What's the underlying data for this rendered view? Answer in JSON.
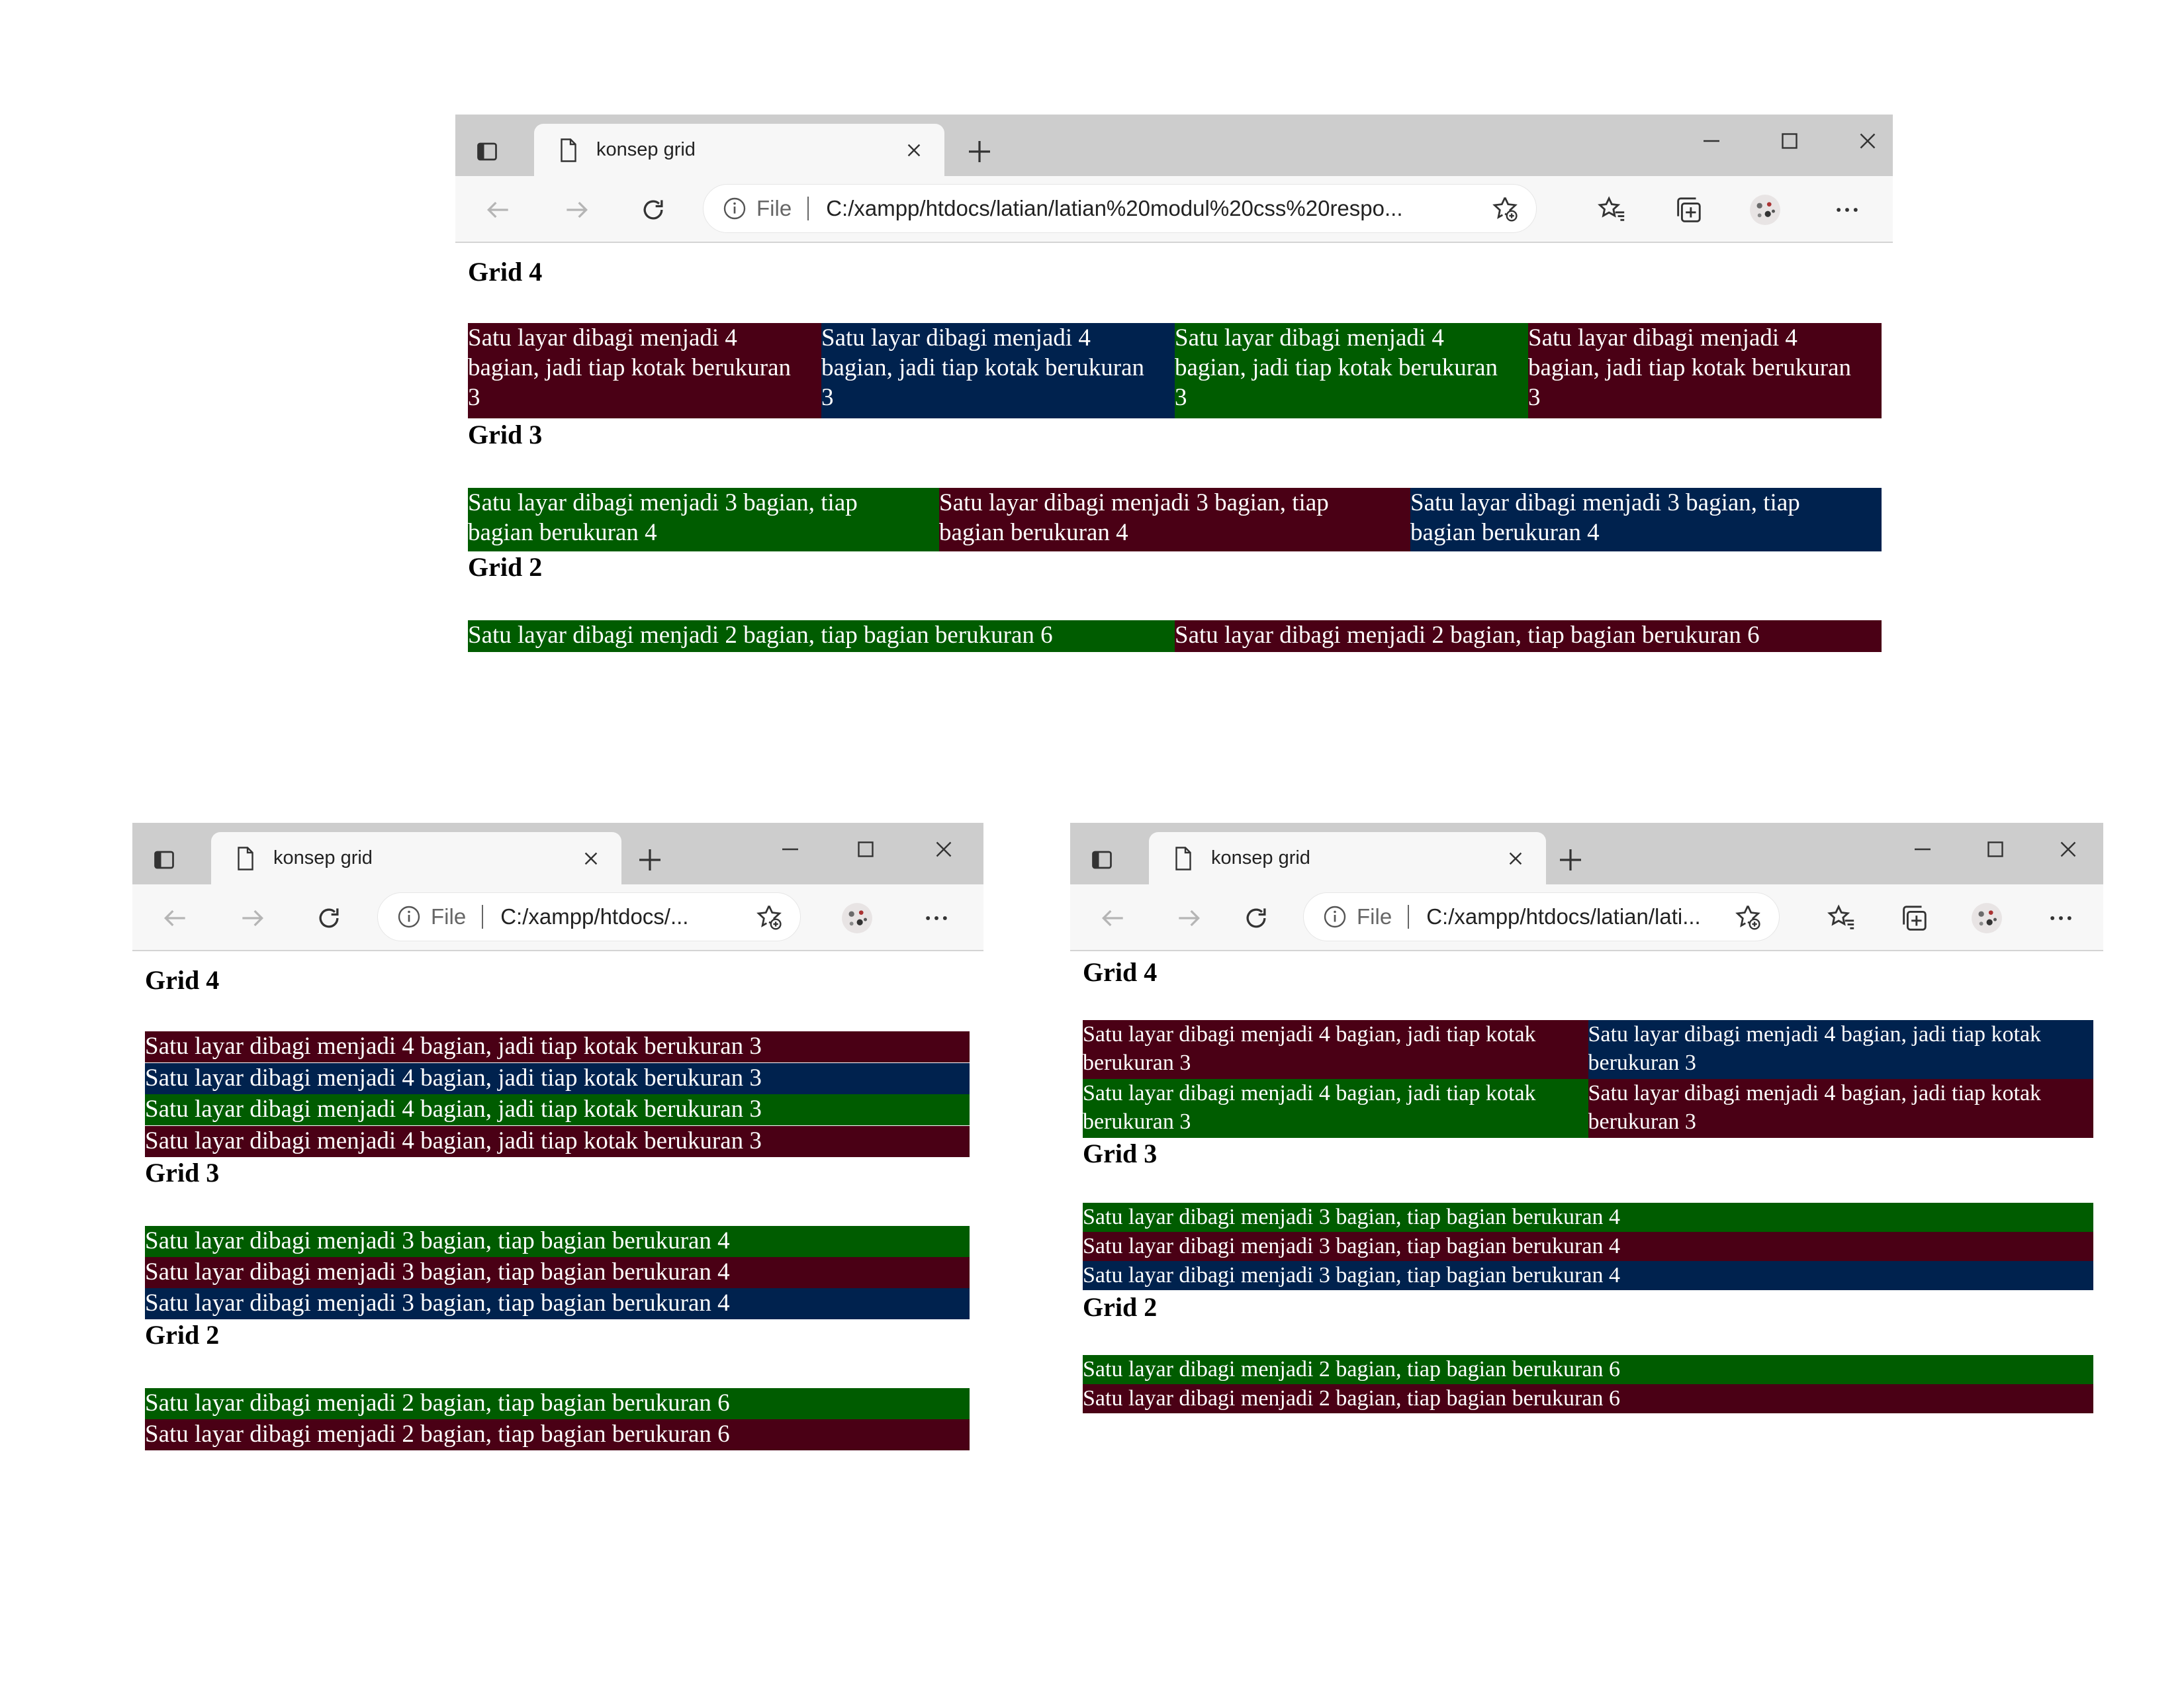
{
  "browser": {
    "tab_title": "konsep grid",
    "file_label": "File",
    "url_full": "C:/xampp/htdocs/latian/latian%20modul%20css%20respo...",
    "url_short": "C:/xampp/htdocs/...",
    "url_medium": "C:/xampp/htdocs/latian/lati..."
  },
  "headings": {
    "grid4": "Grid 4",
    "grid3": "Grid 3",
    "grid2": "Grid 2"
  },
  "text": {
    "grid4": "Satu layar dibagi menjadi 4 bagian, jadi tiap kotak berukuran 3",
    "grid3": "Satu layar dibagi menjadi 3 bagian, tiap bagian berukuran 4",
    "grid2": "Satu layar dibagi menjadi 2 bagian, tiap bagian berukuran 6"
  },
  "colors": {
    "maroon": "#4a0015",
    "navy": "#00224e",
    "green": "#005c00",
    "titlebar": "#cdcdcd",
    "toolbar": "#f7f7f7"
  },
  "screens": [
    {
      "name": "desktop-wide",
      "url_key": "url_full",
      "grid4_colors": [
        "maroon",
        "navy",
        "green",
        "maroon"
      ],
      "grid3_colors": [
        "green",
        "maroon",
        "navy"
      ],
      "grid2_colors": [
        "green",
        "maroon"
      ]
    },
    {
      "name": "mobile-narrow",
      "url_key": "url_short",
      "grid4_colors": [
        "maroon",
        "navy",
        "green",
        "maroon"
      ],
      "grid3_colors": [
        "green",
        "maroon",
        "navy"
      ],
      "grid2_colors": [
        "green",
        "maroon"
      ]
    },
    {
      "name": "tablet-medium",
      "url_key": "url_medium",
      "grid4_colors": [
        "maroon",
        "navy",
        "green",
        "maroon"
      ],
      "grid3_colors": [
        "green",
        "maroon",
        "navy"
      ],
      "grid2_colors": [
        "green",
        "maroon"
      ]
    }
  ]
}
